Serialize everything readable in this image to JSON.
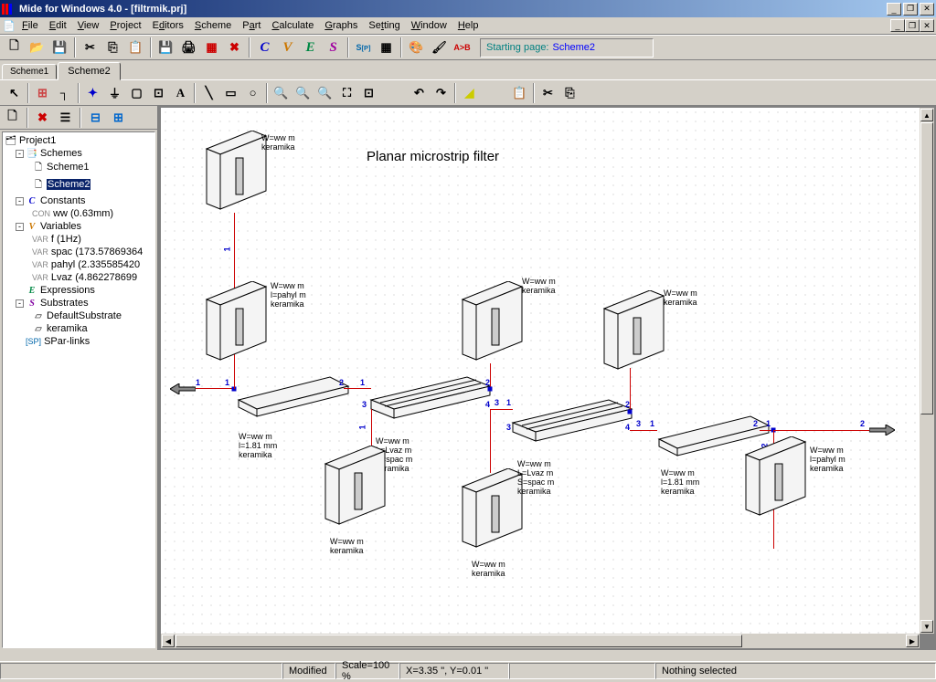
{
  "titlebar": {
    "title": "Mide for Windows 4.0 - [filtrmik.prj]"
  },
  "menu": {
    "items": [
      "File",
      "Edit",
      "View",
      "Project",
      "Editors",
      "Scheme",
      "Part",
      "Calculate",
      "Graphs",
      "Setting",
      "Window",
      "Help"
    ]
  },
  "startpage": {
    "label": "Starting page:",
    "link": "Scheme2"
  },
  "tabs": {
    "items": [
      "Scheme1",
      "Scheme2"
    ],
    "active": 1
  },
  "tree": {
    "root": "Project1",
    "schemes": {
      "label": "Schemes",
      "items": [
        "Scheme1",
        "Scheme2"
      ],
      "selected": 1
    },
    "constants": {
      "label": "Constants",
      "items": [
        "ww (0.63mm)"
      ]
    },
    "variables": {
      "label": "Variables",
      "items": [
        "f (1Hz)",
        "spac (173.57869364",
        "pahyl (2.335585420",
        "Lvaz (4.862278699"
      ]
    },
    "expressions": {
      "label": "Expressions"
    },
    "substrates": {
      "label": "Substrates",
      "items": [
        "DefaultSubstrate",
        "keramika"
      ]
    },
    "sparlinks": {
      "label": "SPar-links"
    }
  },
  "diagram": {
    "title": "Planar microstrip filter",
    "labels": {
      "stub_wk": "W=ww m\nkeramika",
      "open_stub": "W=ww m\nl=pahyl m\nkeramika",
      "line181": "W=ww m\nl=1.81 mm\nkeramika",
      "coupled": "W=ww m\nL=Lvaz m\nS=spac m\nkeramika"
    }
  },
  "status": {
    "modified": "Modified",
    "scale": "Scale=100 %",
    "coords": "X=3.35 \", Y=0.01 \"",
    "selection": "Nothing selected"
  }
}
